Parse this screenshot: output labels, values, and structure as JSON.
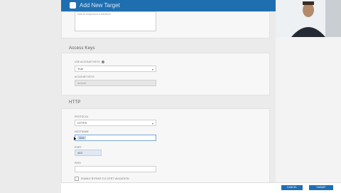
{
  "header": {
    "title": "Add New Target"
  },
  "sections": {
    "top": {
      "textarea_value": "Add an endpoint to a backend"
    },
    "access_keys": {
      "title": "Access Keys",
      "use_account_keys_label": "USE ACCOUNT KEYS",
      "use_account_keys_value": "True",
      "account_keys_label": "ACCOUNT KEYS",
      "account_keys_value": "default"
    },
    "http": {
      "title": "HTTP",
      "protocol_label": "PROTOCOL",
      "protocol_value": "HTTPS",
      "hostname_label": "HOSTNAME",
      "hostname_value": "1111",
      "port_label": "PORT",
      "port_value": "443",
      "path_label": "PATH",
      "path_value": "",
      "checkbox_label": "ENABLE BYPASS TLS CERT VALIDATION"
    }
  },
  "footer": {
    "cancel_label": "CANCEL",
    "submit_label": "SUBMIT"
  },
  "colors": {
    "brand": "#1f6fb0",
    "background": "#ebebeb",
    "card": "#f7f7f7"
  }
}
